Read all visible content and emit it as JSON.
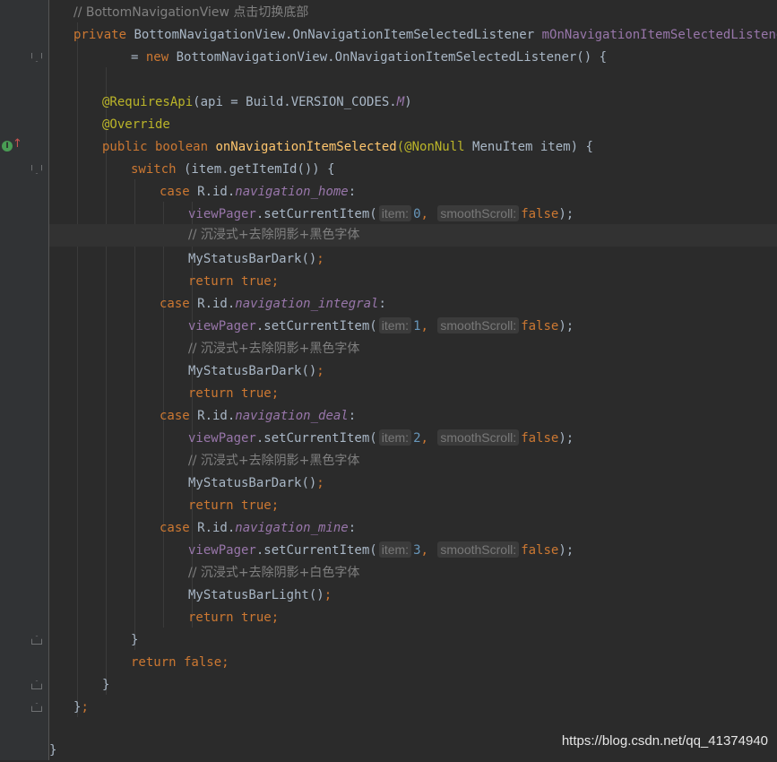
{
  "lines": {
    "l1_comment": "// BottomNavigationView 点击切换底部",
    "l2_private": "private",
    "l2_type": " BottomNavigationView.OnNavigationItemSelectedListener ",
    "l2_field": "mOnNavigationItemSelectedListener",
    "l3_eq": "= ",
    "l3_new": "new",
    "l3_rest": " BottomNavigationView.OnNavigationItemSelectedListener() {",
    "l4_ann": "@RequiresApi",
    "l4_a": "(api = Build.",
    "l4_b": "VERSION_CODES.",
    "l4_c": "M",
    "l4_d": ")",
    "l5_ann": "@Override",
    "l6_public": "public",
    "l6_boolean": " boolean ",
    "l6_fn": "onNavigationItemSelected",
    "l6_ann": "(@NonNull",
    "l6_rest": " MenuItem item) {",
    "l7_switch": "switch",
    "l7_rest": " (item.getItemId()) {",
    "case": "case",
    "rid": " R.id.",
    "colon": ":",
    "nav_home": "navigation_home",
    "nav_integral": "navigation_integral",
    "nav_deal": "navigation_deal",
    "nav_mine": "navigation_mine",
    "viewpager": "viewPager",
    "set_current": ".setCurrentItem(",
    "hint_item": "item:",
    "hint_smooth": "smoothScroll:",
    "idx0": "0",
    "idx1": "1",
    "idx2": "2",
    "idx3": "3",
    "comma": ",",
    "false_kw": "false",
    "close_call": ");",
    "comment_dark": "// 沉浸式+去除阴影+黑色字体",
    "comment_light": "// 沉浸式+去除阴影+白色字体",
    "dark_call": "MyStatusBarDark",
    "light_call": "MyStatusBarLight",
    "parens": "()",
    "semi": ";",
    "return_kw": "return",
    "true_kw": " true",
    "false_ret": " false",
    "brace_close": "}",
    "brace_close_semi": "}",
    "final_brace": "}"
  },
  "watermark": "https://blog.csdn.net/qq_41374940",
  "gutter_icons": {
    "impl": "implementing-method-icon",
    "impl_letter": "I",
    "arrow": "↑"
  }
}
